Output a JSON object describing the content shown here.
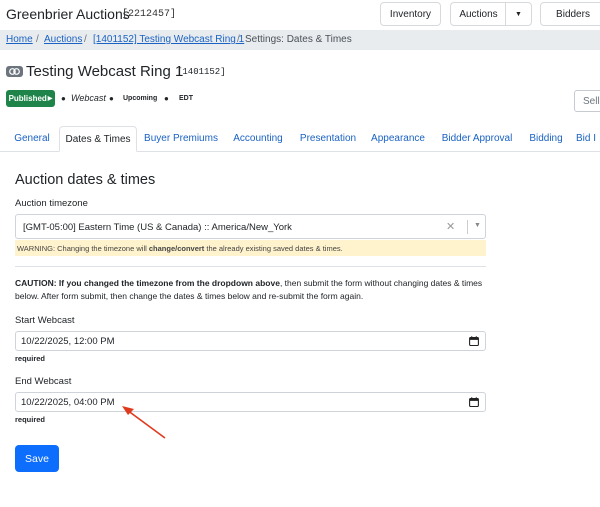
{
  "topbar": {
    "brand": "Greenbrier Auctions",
    "brand_id": "[2212457]",
    "inventory_label": "Inventory",
    "auctions_label": "Auctions",
    "bidders_label": "Bidders"
  },
  "breadcrumb": {
    "home": "Home",
    "auctions": "Auctions",
    "auction": "[1401152] Testing Webcast Ring 1",
    "current": "Settings: Dates & Times",
    "separator": "/"
  },
  "page": {
    "title": "Testing Webcast Ring 1",
    "id": "[1401152]",
    "status_label": "Published",
    "meta": [
      "Webcast",
      "Upcoming",
      "EDT"
    ],
    "seller_label": "Selle"
  },
  "tabs": [
    "General",
    "Dates & Times",
    "Buyer Premiums",
    "Accounting",
    "Presentation",
    "Appearance",
    "Bidder Approval",
    "Bidding",
    "Bid I"
  ],
  "active_tab": "Dates & Times",
  "form": {
    "heading": "Auction dates & times",
    "timezone_label": "Auction timezone",
    "timezone_value": "[GMT-05:00] Eastern Time (US & Canada) :: America/New_York",
    "warning_pre": "WARNING: Changing the timezone will ",
    "warning_bold": "change/convert",
    "warning_post": " the already existing saved dates & times.",
    "caution_bold": "CAUTION: If you changed the timezone from the dropdown above",
    "caution_text": ", then submit the form without changing dates & times below. After form submit, then change the dates & times below and re-submit the form again.",
    "start_label": "Start Webcast",
    "start_value": "10/22/2025, 12:00  PM",
    "start_required": "required",
    "end_label": "End Webcast",
    "end_value": "10/22/2025, 04:00  PM",
    "end_required": "required",
    "save_label": "Save"
  },
  "colors": {
    "link": "#1a62c3",
    "published": "#1e8449",
    "warning_bg": "#fff3cd",
    "save": "#0d6efd",
    "arrow": "#e03a1e"
  }
}
